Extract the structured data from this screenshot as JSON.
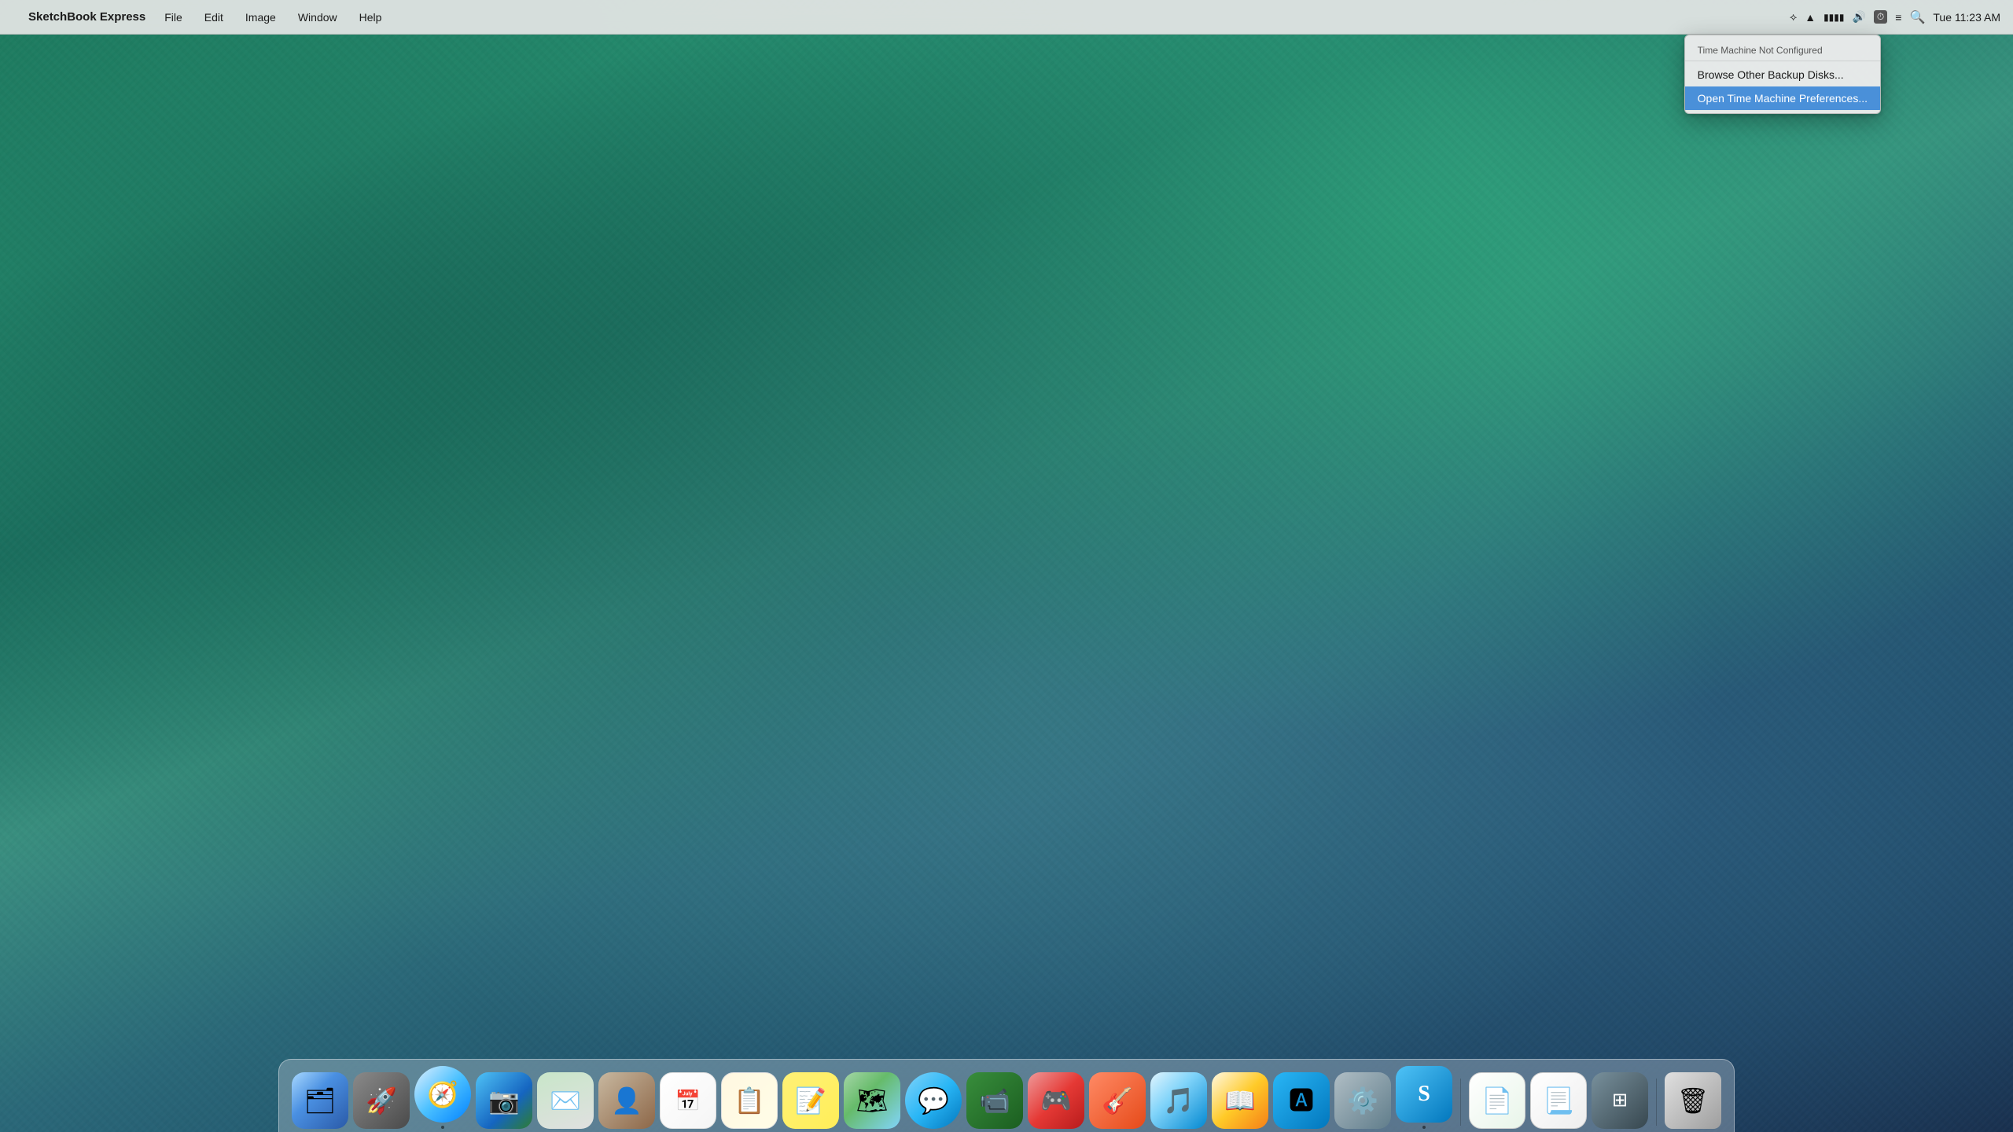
{
  "menubar": {
    "apple_logo": "",
    "app_name": "SketchBook Express",
    "menus": [
      "File",
      "Edit",
      "Image",
      "Window",
      "Help"
    ],
    "clock": "Tue 11:23 AM",
    "search_icon": "🔍",
    "wifi_icon": "wifi",
    "bluetooth_icon": "bluetooth",
    "volume_icon": "volume",
    "battery_icon": "battery",
    "time_machine_icon": "clock"
  },
  "dropdown": {
    "header": "Time Machine Not Configured",
    "items": [
      {
        "label": "Browse Other Backup Disks...",
        "highlighted": false
      },
      {
        "label": "Open Time Machine Preferences...",
        "highlighted": true
      }
    ]
  },
  "dock": {
    "icons": [
      {
        "name": "Finder",
        "emoji": "🗂️",
        "color_class": "icon-finder",
        "dot": false
      },
      {
        "name": "Rocket",
        "emoji": "🚀",
        "color_class": "icon-rocket",
        "dot": false
      },
      {
        "name": "Safari",
        "emoji": "🧭",
        "color_class": "icon-safari",
        "dot": true
      },
      {
        "name": "iPhoto",
        "emoji": "📷",
        "color_class": "icon-iphoto",
        "dot": false
      },
      {
        "name": "Mail",
        "emoji": "✉️",
        "color_class": "icon-mail",
        "dot": false
      },
      {
        "name": "Contacts",
        "emoji": "👤",
        "color_class": "icon-contacts",
        "dot": false
      },
      {
        "name": "Calendar",
        "emoji": "📅",
        "color_class": "icon-calendar",
        "dot": false
      },
      {
        "name": "Reminders",
        "emoji": "📋",
        "color_class": "icon-reminders",
        "dot": false
      },
      {
        "name": "Stickies",
        "emoji": "📝",
        "color_class": "icon-stickies",
        "dot": false
      },
      {
        "name": "Maps",
        "emoji": "🗺️",
        "color_class": "icon-maps",
        "dot": false
      },
      {
        "name": "Messages",
        "emoji": "💬",
        "color_class": "icon-messages",
        "dot": false
      },
      {
        "name": "FaceTime",
        "emoji": "📹",
        "color_class": "icon-facetime",
        "dot": false
      },
      {
        "name": "Game Center",
        "emoji": "🎮",
        "color_class": "icon-game-center",
        "dot": false
      },
      {
        "name": "GarageBand",
        "emoji": "🎸",
        "color_class": "icon-garage",
        "dot": false
      },
      {
        "name": "iTunes",
        "emoji": "🎵",
        "color_class": "icon-itunes",
        "dot": false
      },
      {
        "name": "iBooks",
        "emoji": "📖",
        "color_class": "icon-ibooks",
        "dot": false
      },
      {
        "name": "App Store",
        "emoji": "🅰️",
        "color_class": "icon-appstore",
        "dot": false
      },
      {
        "name": "System Preferences",
        "emoji": "⚙️",
        "color_class": "icon-sysprefs",
        "dot": false
      },
      {
        "name": "Scrivener",
        "emoji": "S",
        "color_class": "icon-scrivener",
        "dot": true
      },
      {
        "name": "separator",
        "emoji": "",
        "color_class": "",
        "dot": false
      },
      {
        "name": "Pages",
        "emoji": "📄",
        "color_class": "icon-pages",
        "dot": false
      },
      {
        "name": "Doc Reviewer",
        "emoji": "📃",
        "color_class": "icon-docreviewer",
        "dot": false
      },
      {
        "name": "Expose",
        "emoji": "⊞",
        "color_class": "icon-exposee",
        "dot": false
      },
      {
        "name": "separator2",
        "emoji": "",
        "color_class": "",
        "dot": false
      },
      {
        "name": "Trash",
        "emoji": "🗑️",
        "color_class": "icon-trash",
        "dot": false
      }
    ]
  }
}
